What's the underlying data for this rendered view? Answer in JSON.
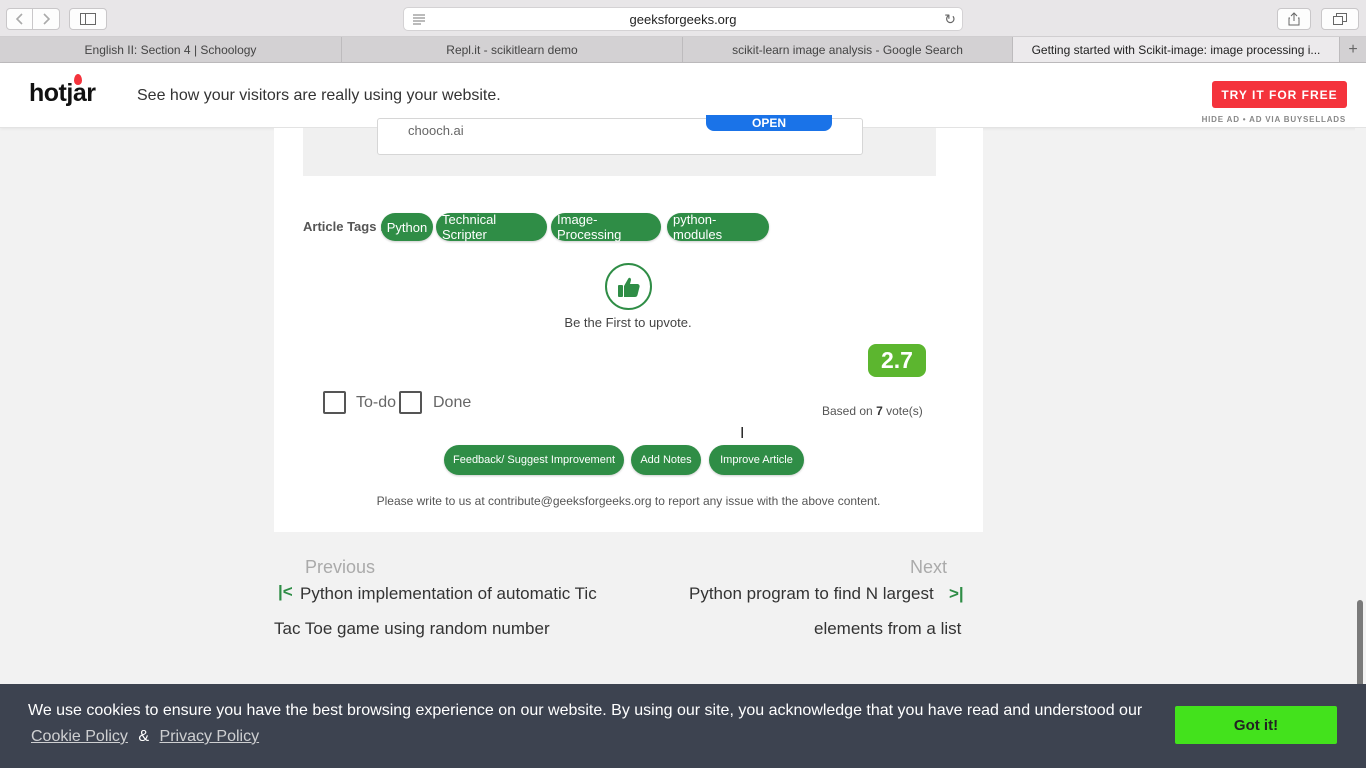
{
  "browser": {
    "url": "geeksforgeeks.org",
    "tabs": [
      {
        "label": "English II: Section 4 | Schoology"
      },
      {
        "label": "Repl.it - scikitlearn demo"
      },
      {
        "label": "scikit-learn image analysis - Google Search"
      },
      {
        "label": "Getting started with Scikit-image: image processing i..."
      }
    ],
    "active_tab": 3
  },
  "ad": {
    "brand": "hotjar",
    "text": "See how your visitors are really using your website.",
    "cta": "TRY IT FOR FREE",
    "hide_text": "HIDE AD • AD VIA BUYSELLADS",
    "inner_domain": "chooch.ai",
    "inner_cta": "OPEN"
  },
  "article": {
    "tags_label": "Article Tags :",
    "tags": [
      "Python",
      "Technical Scripter",
      "Image-Processing",
      "python-modules"
    ],
    "upvote_text": "Be the First to upvote.",
    "rating": "2.7",
    "votes_prefix": "Based on",
    "votes_count": "7",
    "votes_suffix": "vote(s)",
    "todo_label": "To-do",
    "done_label": "Done",
    "buttons": {
      "feedback": "Feedback/ Suggest Improvement",
      "notes": "Add Notes",
      "improve": "Improve Article"
    },
    "contribute_text": "Please write to us at contribute@geeksforgeeks.org to report any issue with the above content."
  },
  "navigation": {
    "prev_label": "Previous",
    "prev_title_line1": "Python implementation of automatic Tic",
    "prev_title_line2": "Tac Toe game using random number",
    "next_label": "Next",
    "next_title_line1": "Python program to find N largest",
    "next_title_line2": "elements from a list"
  },
  "cookie": {
    "text": "We use cookies to ensure you have the best browsing experience on our website. By using our site, you acknowledge that you have read and understood our",
    "cookie_policy": "Cookie Policy",
    "ampersand": "&",
    "privacy_policy": "Privacy Policy",
    "button": "Got it!"
  },
  "colors": {
    "gfg_green": "#2f8d46",
    "rating_green": "#5cb62f",
    "hotjar_red": "#f4333c",
    "cookie_bg": "#3d4350",
    "cookie_button": "#43e21c"
  }
}
